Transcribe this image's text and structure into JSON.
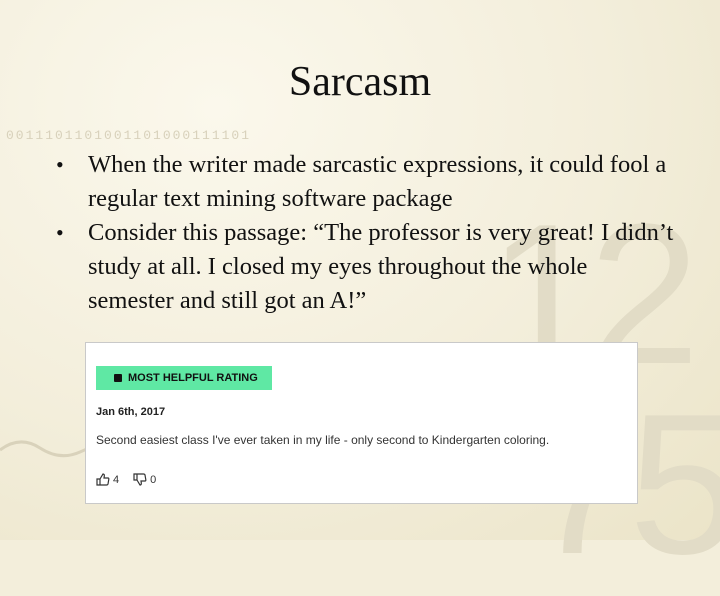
{
  "slide": {
    "title": "Sarcasm",
    "bullets": [
      "When the writer made sarcastic expressions, it could fool a regular text mining software package",
      "Consider this passage: “The professor is very great! I didn’t study at all. I closed my eyes throughout the whole semester and still got an A!”"
    ]
  },
  "background": {
    "code_text": "0011101101001101000111101",
    "digits_top": "12",
    "digits_bottom": "75"
  },
  "review": {
    "badge_label": "MOST HELPFUL RATING",
    "badge_icon": "flag-icon",
    "date": "Jan 6th, 2017",
    "comment": "Second easiest class I've ever taken in my life - only second to Kindergarten coloring.",
    "thumbs_up_count": "4",
    "thumbs_down_count": "0",
    "colors": {
      "badge": "#5fe8a4"
    }
  }
}
